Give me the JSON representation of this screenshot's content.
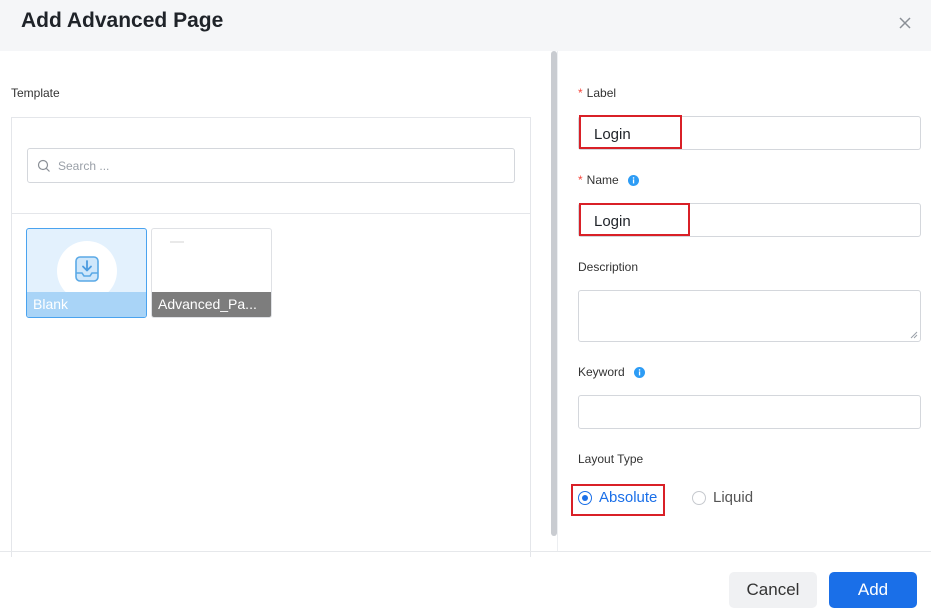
{
  "dialog": {
    "title": "Add Advanced Page"
  },
  "template": {
    "label": "Template",
    "search_placeholder": "Search ...",
    "cards": [
      {
        "label": "Blank",
        "selected": true
      },
      {
        "label": "Advanced_Pa..."
      }
    ]
  },
  "form": {
    "label": {
      "required_mark": "*",
      "title": "Label",
      "value": "Login"
    },
    "name": {
      "required_mark": "*",
      "title": "Name",
      "value": "Login"
    },
    "description": {
      "title": "Description",
      "value": ""
    },
    "keyword": {
      "title": "Keyword",
      "value": ""
    },
    "layout_type": {
      "title": "Layout Type",
      "options": [
        "Absolute",
        "Liquid"
      ],
      "selected": "Absolute"
    }
  },
  "footer": {
    "cancel_label": "Cancel",
    "add_label": "Add"
  },
  "colors": {
    "primary": "#1a6fe8",
    "highlight": "#d92027",
    "required": "#f5463c",
    "info_icon": "#2d9cf5"
  }
}
